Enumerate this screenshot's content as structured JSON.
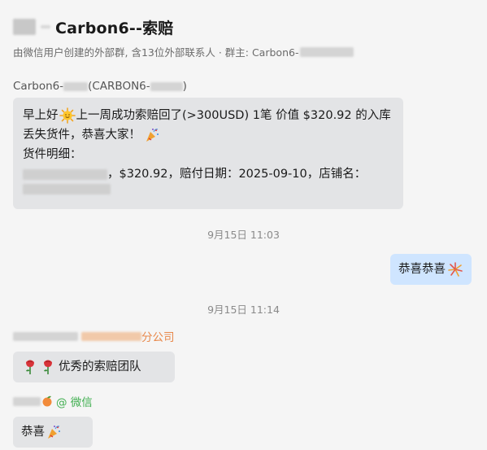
{
  "header": {
    "title": "Carbon6--索赔",
    "subtitle": "由微信用户创建的外部群, 含13位外部联系人 · 群主: Carbon6-"
  },
  "messages": {
    "msg1": {
      "sender_prefix": "Carbon6-",
      "sender_mid": "(CARBON6-",
      "sender_suffix": ")",
      "line1a": "早上好",
      "line1b": "上一周成功索赔回了(>300USD) 1笔 价值 $320.92 的入库",
      "line2": "丢失货件，恭喜大家！",
      "line3": "货件明细：",
      "line4": "，$320.92，赔付日期：2025-09-10，店铺名："
    },
    "ts1": "9月15日 11:03",
    "msg2": {
      "text": "恭喜恭喜"
    },
    "ts2": "9月15日 11:14",
    "msg3": {
      "sender_suffix": "分公司",
      "text": "优秀的索赔团队"
    },
    "msg4": {
      "sender_suffix": "@ 微信",
      "text": "恭喜"
    }
  },
  "colors": {
    "background": "#f5f5f5",
    "bubble_incoming": "#e3e4e6",
    "bubble_outgoing": "#cfe5ff",
    "company_orange": "#e8884a",
    "wechat_green": "#3fae4f"
  }
}
